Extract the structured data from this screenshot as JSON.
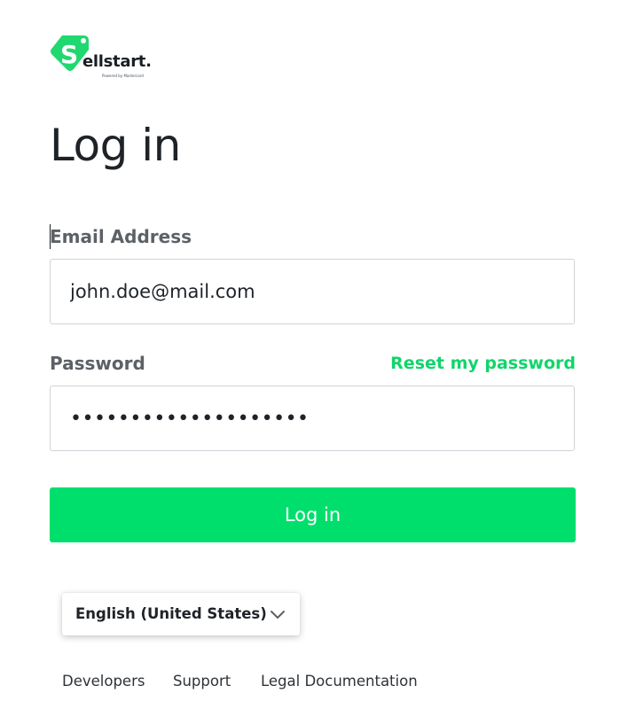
{
  "brand": {
    "wordmark": "ellstart.",
    "tagline": "Powered by Mastercard",
    "accent_color": "#00df6c",
    "link_color": "#10d56a",
    "logo_icon": "price-tag-s-icon"
  },
  "page": {
    "title": "Log in"
  },
  "form": {
    "email": {
      "label": "Email Address",
      "value": "john.doe@mail.com"
    },
    "password": {
      "label": "Password",
      "value": "••••••••••••••••••••",
      "reset_link": "Reset my password"
    },
    "submit_label": "Log in"
  },
  "language": {
    "selected": "English (United States)",
    "icon": "chevron-down-icon"
  },
  "footer": {
    "links": [
      "Developers",
      "Support",
      "Legal Documentation"
    ]
  }
}
